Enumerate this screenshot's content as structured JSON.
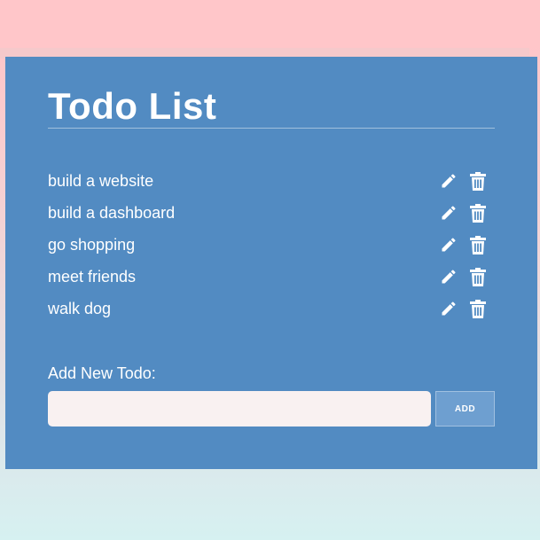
{
  "header": {
    "title": "Todo List"
  },
  "todos": [
    {
      "text": "build a website"
    },
    {
      "text": "build a dashboard"
    },
    {
      "text": "go shopping"
    },
    {
      "text": "meet friends"
    },
    {
      "text": "walk dog"
    }
  ],
  "item_icons": {
    "edit": "pencil-icon",
    "delete": "trash-icon"
  },
  "add_form": {
    "label": "Add New Todo:",
    "input_value": "",
    "input_placeholder": "",
    "button_label": "ADD"
  },
  "colors": {
    "card_background": "#528bc2",
    "page_background_top": "#ffc6c9",
    "page_background_bottom": "#d6f1f1",
    "input_background": "#f9f1f1",
    "add_button_background": "#6e9fd0",
    "text": "#ffffff"
  }
}
